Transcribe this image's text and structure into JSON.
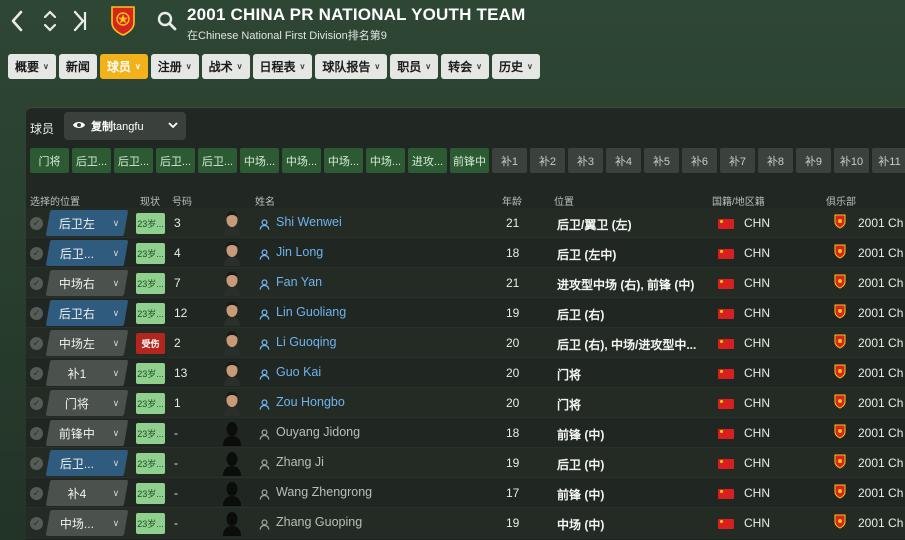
{
  "header": {
    "title": "2001 CHINA PR NATIONAL YOUTH TEAM",
    "subtitle": "在Chinese National First Division排名第9",
    "back_icon": "chevron-left-icon",
    "updown_icon": "up-down-chevron-icon",
    "forward_icon": "skip-forward-icon",
    "search_icon": "search-icon",
    "crest_colors": {
      "fill": "#d8241c",
      "accent": "#f5c518"
    }
  },
  "tabs": [
    {
      "label": "概要",
      "dropdown": true
    },
    {
      "label": "新闻",
      "dropdown": false
    },
    {
      "label": "球员",
      "dropdown": true,
      "active": true
    },
    {
      "label": "注册",
      "dropdown": true
    },
    {
      "label": "战术",
      "dropdown": true
    },
    {
      "label": "日程表",
      "dropdown": true
    },
    {
      "label": "球队报告",
      "dropdown": true
    },
    {
      "label": "职员",
      "dropdown": true
    },
    {
      "label": "转会",
      "dropdown": true
    },
    {
      "label": "历史",
      "dropdown": true
    }
  ],
  "panel": {
    "title": "球员",
    "view": {
      "prefix": "复制",
      "name": "tangfu",
      "icon": "eye-icon"
    }
  },
  "position_chips": [
    {
      "label": "门将",
      "filled": true
    },
    {
      "label": "后卫...",
      "filled": true
    },
    {
      "label": "后卫...",
      "filled": true
    },
    {
      "label": "后卫...",
      "filled": true
    },
    {
      "label": "后卫...",
      "filled": true
    },
    {
      "label": "中场...",
      "filled": true
    },
    {
      "label": "中场...",
      "filled": true
    },
    {
      "label": "中场...",
      "filled": true
    },
    {
      "label": "中场...",
      "filled": true
    },
    {
      "label": "进攻...",
      "filled": true
    },
    {
      "label": "前锋中",
      "filled": true
    },
    {
      "label": "补1",
      "filled": false
    },
    {
      "label": "补2",
      "filled": false
    },
    {
      "label": "补3",
      "filled": false
    },
    {
      "label": "补4",
      "filled": false
    },
    {
      "label": "补5",
      "filled": false
    },
    {
      "label": "补6",
      "filled": false
    },
    {
      "label": "补7",
      "filled": false
    },
    {
      "label": "补8",
      "filled": false
    },
    {
      "label": "补9",
      "filled": false
    },
    {
      "label": "补10",
      "filled": false
    },
    {
      "label": "补11",
      "filled": false
    }
  ],
  "columns": {
    "selected_position": "选择的位置",
    "status": "现状",
    "number": "号码",
    "name": "姓名",
    "age": "年龄",
    "position": "位置",
    "nationality": "国籍/地区籍",
    "club": "俱乐部"
  },
  "players": [
    {
      "sel_pos": "后卫左",
      "pill": "blue",
      "status": "23岁...",
      "status_type": "u23",
      "number": "3",
      "name": "Shi Wenwei",
      "first_team": true,
      "has_photo": true,
      "age": "21",
      "position": "后卫/翼卫 (左)",
      "nation": "CHN",
      "club": "2001 Ch"
    },
    {
      "sel_pos": "后卫...",
      "pill": "blue",
      "status": "23岁...",
      "status_type": "u23",
      "number": "4",
      "name": "Jin Long",
      "first_team": true,
      "has_photo": true,
      "age": "18",
      "position": "后卫 (左中)",
      "nation": "CHN",
      "club": "2001 Ch"
    },
    {
      "sel_pos": "中场右",
      "pill": "gray",
      "status": "23岁...",
      "status_type": "u23",
      "number": "7",
      "name": "Fan Yan",
      "first_team": true,
      "has_photo": true,
      "age": "21",
      "position": "进攻型中场 (右), 前锋 (中)",
      "nation": "CHN",
      "club": "2001 Ch"
    },
    {
      "sel_pos": "后卫右",
      "pill": "blue",
      "status": "23岁...",
      "status_type": "u23",
      "number": "12",
      "name": "Lin Guoliang",
      "first_team": true,
      "has_photo": true,
      "age": "19",
      "position": "后卫 (右)",
      "nation": "CHN",
      "club": "2001 Ch"
    },
    {
      "sel_pos": "中场左",
      "pill": "gray",
      "status": "受伤",
      "status_type": "inj",
      "number": "2",
      "name": "Li Guoqing",
      "first_team": true,
      "has_photo": true,
      "age": "20",
      "position": "后卫 (右), 中场/进攻型中...",
      "nation": "CHN",
      "club": "2001 Ch"
    },
    {
      "sel_pos": "补1",
      "pill": "gray",
      "status": "23岁...",
      "status_type": "u23",
      "number": "13",
      "name": "Guo Kai",
      "first_team": true,
      "has_photo": true,
      "age": "20",
      "position": "门将",
      "nation": "CHN",
      "club": "2001 Ch"
    },
    {
      "sel_pos": "门将",
      "pill": "gray",
      "status": "23岁...",
      "status_type": "u23",
      "number": "1",
      "name": "Zou Hongbo",
      "first_team": true,
      "has_photo": true,
      "age": "20",
      "position": "门将",
      "nation": "CHN",
      "club": "2001 Ch"
    },
    {
      "sel_pos": "前锋中",
      "pill": "gray",
      "status": "23岁...",
      "status_type": "u23",
      "number": "-",
      "name": "Ouyang Jidong",
      "first_team": false,
      "has_photo": false,
      "age": "18",
      "position": "前锋 (中)",
      "nation": "CHN",
      "club": "2001 Ch"
    },
    {
      "sel_pos": "后卫...",
      "pill": "blue",
      "status": "23岁...",
      "status_type": "u23",
      "number": "-",
      "name": "Zhang Ji",
      "first_team": false,
      "has_photo": false,
      "age": "19",
      "position": "后卫 (中)",
      "nation": "CHN",
      "club": "2001 Ch"
    },
    {
      "sel_pos": "补4",
      "pill": "gray",
      "status": "23岁...",
      "status_type": "u23",
      "number": "-",
      "name": "Wang Zhengrong",
      "first_team": false,
      "has_photo": false,
      "age": "17",
      "position": "前锋 (中)",
      "nation": "CHN",
      "club": "2001 Ch"
    },
    {
      "sel_pos": "中场...",
      "pill": "gray",
      "status": "23岁...",
      "status_type": "u23",
      "number": "-",
      "name": "Zhang Guoping",
      "first_team": false,
      "has_photo": false,
      "age": "19",
      "position": "中场 (中)",
      "nation": "CHN",
      "club": "2001 Ch"
    }
  ]
}
